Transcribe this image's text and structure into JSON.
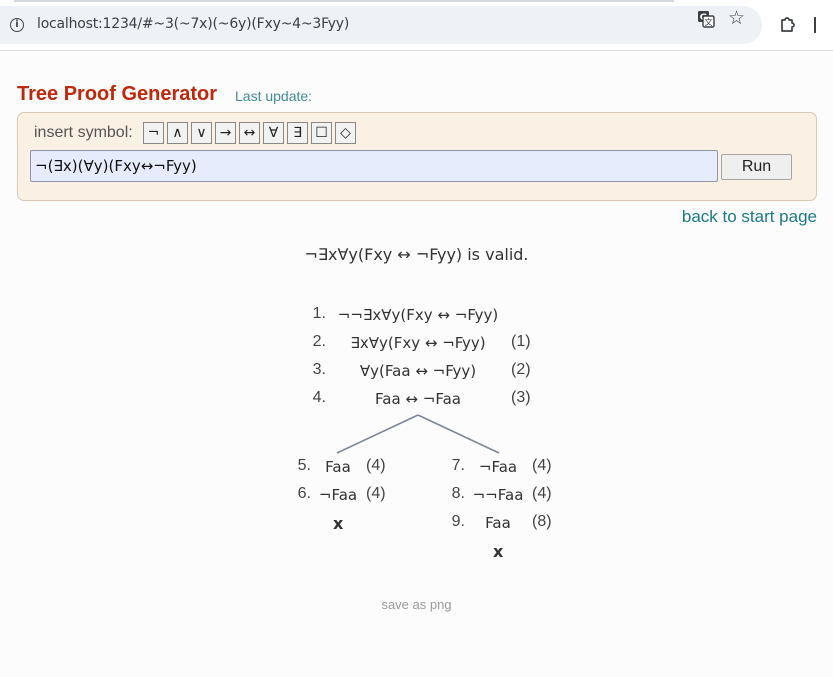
{
  "browser": {
    "url": "localhost:1234/#~3(~7x)(~6y)(Fxy~4~3Fyy)"
  },
  "header": {
    "title": "Tree Proof Generator",
    "last_update": "Last update:"
  },
  "form": {
    "insert_label": "insert symbol:",
    "symbols": [
      "¬",
      "∧",
      "∨",
      "→",
      "↔",
      "∀",
      "∃",
      "☐",
      "◇"
    ],
    "formula_value": "¬(∃x)(∀y)(Fxy↔¬Fyy)",
    "run_label": "Run"
  },
  "nav": {
    "back_label": "back to start page"
  },
  "result": {
    "text": "¬∃x∀y(Fxy ↔ ¬Fyy) is valid."
  },
  "tree": {
    "trunk": [
      {
        "num": "1.",
        "formula": "¬¬∃x∀y(Fxy ↔ ¬Fyy)",
        "ref": ""
      },
      {
        "num": "2.",
        "formula": "∃x∀y(Fxy ↔ ¬Fyy)",
        "ref": "(1)"
      },
      {
        "num": "3.",
        "formula": "∀y(Faa ↔ ¬Fyy)",
        "ref": "(2)"
      },
      {
        "num": "4.",
        "formula": "Faa ↔ ¬Faa",
        "ref": "(3)"
      }
    ],
    "left_branch": [
      {
        "num": "5.",
        "formula": "Faa",
        "ref": "(4)"
      },
      {
        "num": "6.",
        "formula": "¬Faa",
        "ref": "(4)"
      }
    ],
    "right_branch": [
      {
        "num": "7.",
        "formula": "¬Faa",
        "ref": "(4)"
      },
      {
        "num": "8.",
        "formula": "¬¬Faa",
        "ref": "(4)"
      },
      {
        "num": "9.",
        "formula": "Faa",
        "ref": "(8)"
      }
    ],
    "closed_mark": "x"
  },
  "footer": {
    "save_label": "save as png"
  }
}
